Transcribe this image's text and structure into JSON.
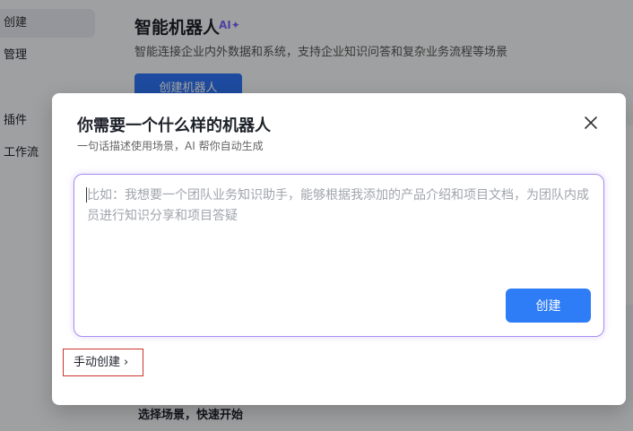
{
  "sidebar": {
    "items": [
      {
        "label": "创建",
        "active": true
      },
      {
        "label": "管理"
      },
      {
        "label": "插件"
      },
      {
        "label": "工作流"
      }
    ]
  },
  "header": {
    "title": "智能机器人",
    "ai_badge": "AI✦",
    "description": "智能连接企业内外数据和系统，支持企业知识问答和复杂业务流程等场景",
    "create_button": "创建机器人"
  },
  "bottom_section": {
    "title": "选择场景，快速开始"
  },
  "modal": {
    "title": "你需要一个什么样的机器人",
    "subtitle": "一句话描述使用场景，AI 帮你自动生成",
    "prompt": {
      "value": "",
      "placeholder": "比如：我想要一个团队业务知识助手，能够根据我添加的产品介绍和项目文档，为团队内成员进行知识分享和项目答疑"
    },
    "submit_label": "创建",
    "manual_create_label": "手动创建",
    "manual_create_chevron": "›",
    "close_icon": "close-icon"
  },
  "colors": {
    "primary": "#2e7cf6",
    "ai_accent": "#7d63f7",
    "highlight_border": "#c8372d"
  }
}
